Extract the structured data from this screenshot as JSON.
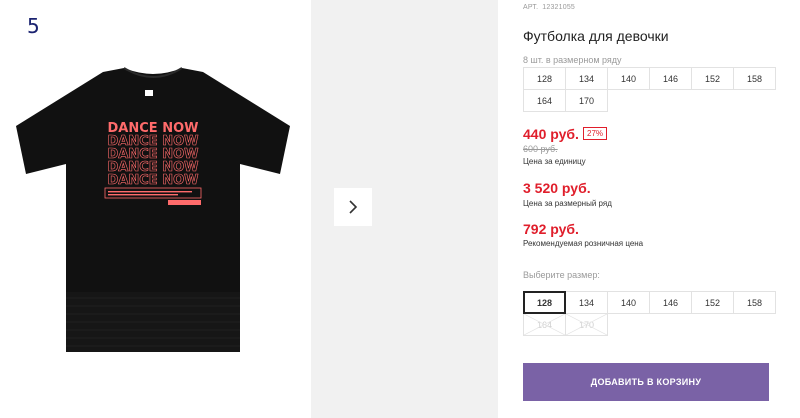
{
  "image_number": "5",
  "product": {
    "art_label": "АРТ.",
    "art_value": "12321055",
    "title": "Футболка для девочки",
    "print_text": "DANCE NOW"
  },
  "pack_label": "8 шт. в размерном ряду",
  "pack_sizes": [
    "128",
    "134",
    "140",
    "146",
    "152",
    "158",
    "164",
    "170"
  ],
  "prices": {
    "unit_price": "440 руб.",
    "discount": "27%",
    "old_price": "600 руб.",
    "unit_caption": "Цена за единицу",
    "pack_price": "3 520 руб.",
    "pack_caption": "Цена за размерный ряд",
    "retail_price": "792 руб.",
    "retail_caption": "Рекомендуемая розничная цена"
  },
  "select_size": {
    "label": "Выберите размер:",
    "options": [
      {
        "label": "128",
        "selected": true,
        "available": true
      },
      {
        "label": "134",
        "selected": false,
        "available": true
      },
      {
        "label": "140",
        "selected": false,
        "available": true
      },
      {
        "label": "146",
        "selected": false,
        "available": true
      },
      {
        "label": "152",
        "selected": false,
        "available": true
      },
      {
        "label": "158",
        "selected": false,
        "available": true
      },
      {
        "label": "164",
        "selected": false,
        "available": false
      },
      {
        "label": "170",
        "selected": false,
        "available": false
      }
    ]
  },
  "add_to_cart_label": "ДОБАВИТЬ В КОРЗИНУ",
  "colors": {
    "price_red": "#e01e2b",
    "button_purple": "#7a62a6",
    "print_red": "#ff6b6b",
    "shirt_black": "#111111"
  },
  "icons": {
    "next": "chevron-right-icon"
  }
}
